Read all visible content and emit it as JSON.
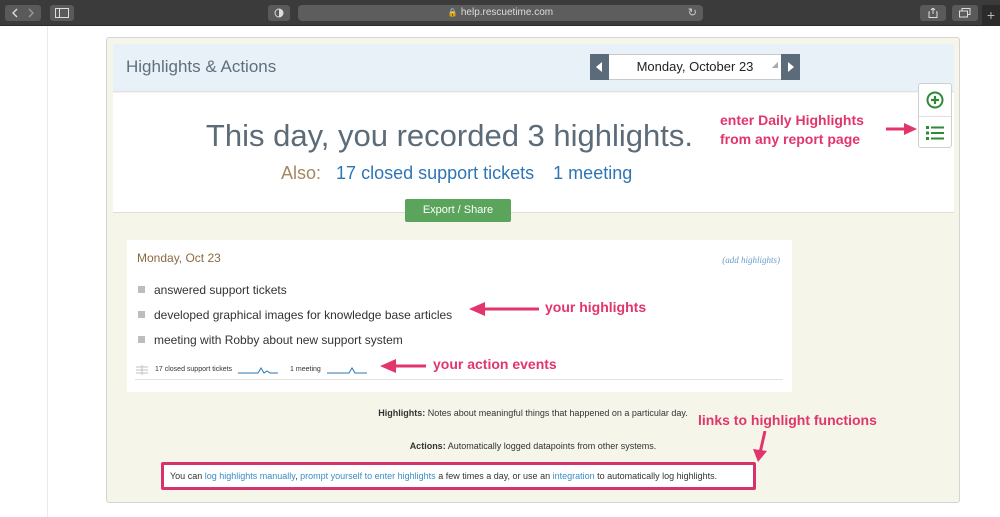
{
  "browser": {
    "url": "help.rescuetime.com"
  },
  "card": {
    "title": "Highlights & Actions",
    "date": "Monday, October 23"
  },
  "hero": {
    "title": "This day, you recorded 3 highlights.",
    "also_label": "Also:",
    "links": [
      "17 closed support tickets",
      "1 meeting"
    ]
  },
  "export_button": "Export / Share",
  "day": {
    "date": "Monday, Oct 23",
    "add_link": "(add highlights)",
    "highlights": [
      "answered support tickets",
      "developed graphical images for knowledge base articles",
      "meeting with Robby about new support system"
    ],
    "events": [
      "17 closed support tickets",
      "1 meeting"
    ]
  },
  "notes": {
    "highlights_label": "Highlights:",
    "highlights_text": "Notes about meaningful things that happened on a particular day.",
    "actions_label": "Actions:",
    "actions_text": "Automatically logged datapoints from other systems."
  },
  "links_sentence": {
    "p1": "You can ",
    "l1": "log highlights manually",
    "p2": ", ",
    "l2": "prompt yourself to enter highlights",
    "p3": " a few times a day, or use an ",
    "l3": "integration",
    "p4": " to automatically log highlights."
  },
  "annotations": {
    "enter_highlights_line1": "enter Daily Highlights",
    "enter_highlights_line2": "from any report page",
    "your_highlights": "your highlights",
    "your_action_events": "your action events",
    "links_to_functions": "links to highlight functions"
  },
  "colors": {
    "annotation": "#e1356b",
    "export_green": "#5aa45c",
    "link_blue": "#2e75b6",
    "header_bg": "#e9f1f8",
    "page_bg": "#f6f5ea"
  }
}
